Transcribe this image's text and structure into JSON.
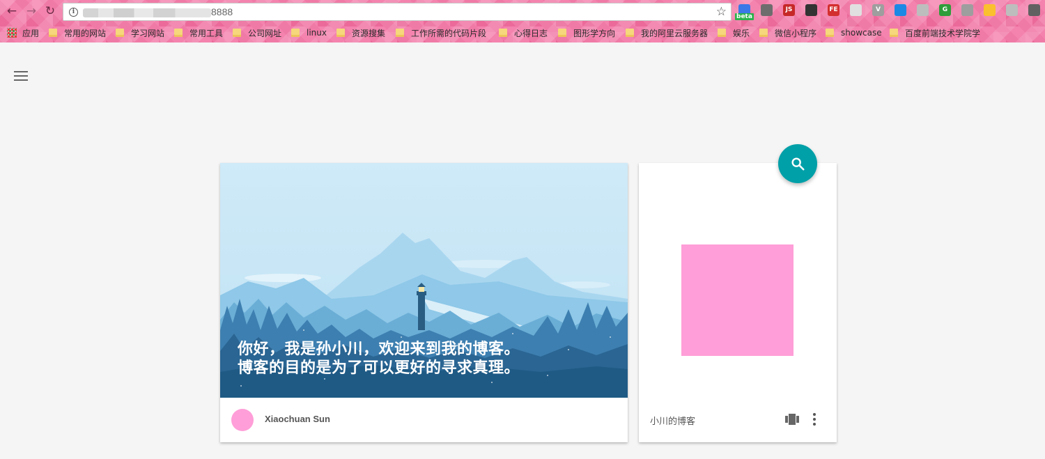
{
  "browser": {
    "url_suffix": "8888",
    "bookmarks": [
      {
        "label": "应用",
        "type": "apps"
      },
      {
        "label": "常用的网站",
        "type": "folder"
      },
      {
        "label": "学习网站",
        "type": "folder"
      },
      {
        "label": "常用工具",
        "type": "folder"
      },
      {
        "label": "公司网址",
        "type": "folder"
      },
      {
        "label": "linux",
        "type": "folder"
      },
      {
        "label": "资源搜集",
        "type": "folder"
      },
      {
        "label": "工作所需的代码片段",
        "type": "folder"
      },
      {
        "label": "心得日志",
        "type": "folder"
      },
      {
        "label": "图形学方向",
        "type": "folder"
      },
      {
        "label": "我的阿里云服务器",
        "type": "folder"
      },
      {
        "label": "娱乐",
        "type": "folder"
      },
      {
        "label": "微信小程序",
        "type": "folder"
      },
      {
        "label": "showcase",
        "type": "folder"
      },
      {
        "label": "百度前端技术学院学",
        "type": "folder"
      }
    ],
    "extensions": [
      {
        "name": "beta-extension-icon",
        "glyph": "",
        "color": "#3b78e7"
      },
      {
        "name": "ghost-extension-icon",
        "glyph": "",
        "color": "#6d6d6d"
      },
      {
        "name": "js-extension-icon",
        "glyph": "JS",
        "color": "#c62828"
      },
      {
        "name": "qrcode-extension-icon",
        "glyph": "",
        "color": "#333333"
      },
      {
        "name": "fe-extension-icon",
        "glyph": "FE",
        "color": "#d32f2f"
      },
      {
        "name": "note-extension-icon",
        "glyph": "",
        "color": "#e0e0e0"
      },
      {
        "name": "vue-extension-icon",
        "glyph": "V",
        "color": "#9e9e9e"
      },
      {
        "name": "download-extension-icon",
        "glyph": "",
        "color": "#1e88e5"
      },
      {
        "name": "book-extension-icon",
        "glyph": "",
        "color": "#bdbdbd"
      },
      {
        "name": "grammarly-extension-icon",
        "glyph": "G",
        "color": "#2e9d3a"
      },
      {
        "name": "play-extension-icon",
        "glyph": "",
        "color": "#9e9e9e"
      },
      {
        "name": "crown-extension-icon",
        "glyph": "",
        "color": "#fbc02d"
      },
      {
        "name": "circle-extension-icon",
        "glyph": "",
        "color": "#bdbdbd"
      },
      {
        "name": "location-extension-icon",
        "glyph": "",
        "color": "#616161"
      }
    ],
    "beta_label": "beta"
  },
  "main_card": {
    "hero_lines": [
      "你好，我是孙小川，欢迎来到我的博客。",
      "博客的目的是为了可以更好的寻求真理。"
    ],
    "author_name": "Xiaochuan Sun"
  },
  "side_card": {
    "title": "小川的博客"
  },
  "colors": {
    "accent": "#00a0a8",
    "avatar_pink": "#ff9ed8",
    "chrome_pink": "#f07aa6"
  }
}
